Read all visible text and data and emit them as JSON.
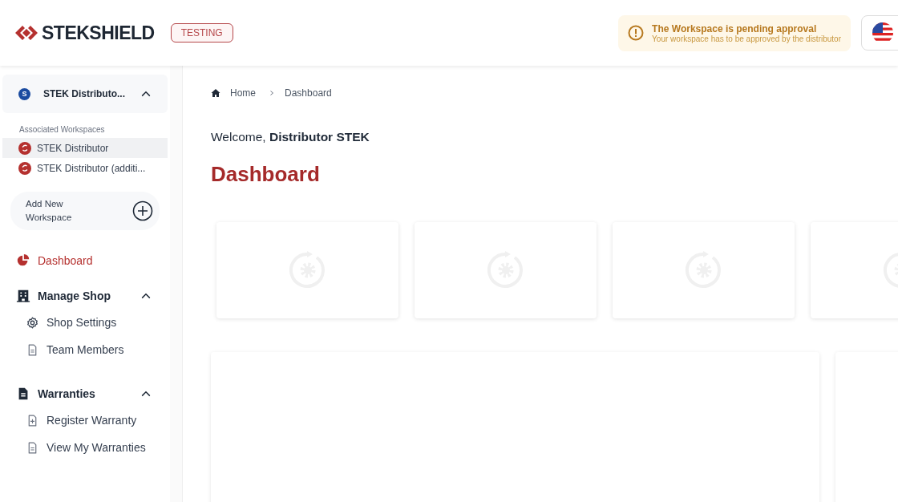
{
  "header": {
    "logo": "STEKSHIELD",
    "env_badge": "TESTING",
    "notice": {
      "title": "The Workspace is pending approval",
      "message": "Your workspace has to be approved by the distributor"
    }
  },
  "sidebar": {
    "workspace": {
      "initial": "S",
      "name": "STEK Distributo...",
      "expanded": true
    },
    "associated_label": "Associated Workspaces",
    "workspaces": [
      {
        "name": "STEK Distributor",
        "selected": true
      },
      {
        "name": "STEK Distributor (additi...",
        "selected": false
      }
    ],
    "add_workspace": "Add New Workspace",
    "nav": [
      {
        "kind": "link",
        "label": "Dashboard",
        "selected": true
      },
      {
        "kind": "group",
        "label": "Manage Shop",
        "expanded": true,
        "children": [
          {
            "label": "Shop Settings",
            "selected": false
          },
          {
            "label": "Team Members",
            "selected": false
          }
        ]
      },
      {
        "kind": "group",
        "label": "Warranties",
        "expanded": true,
        "children": [
          {
            "label": "Register Warranty",
            "selected": false
          },
          {
            "label": "View My Warranties",
            "selected": false
          }
        ]
      }
    ]
  },
  "breadcrumb": [
    "Home",
    "Dashboard"
  ],
  "welcome": "Welcome, **Distributor STEK**",
  "title": "Dashboard",
  "stat_cards": [
    {
      "kind": "loading"
    },
    {
      "kind": "loading"
    },
    {
      "kind": "loading"
    },
    {
      "kind": "loading"
    }
  ],
  "panels": [
    {
      "kind": "empty"
    },
    {
      "kind": "empty"
    }
  ]
}
